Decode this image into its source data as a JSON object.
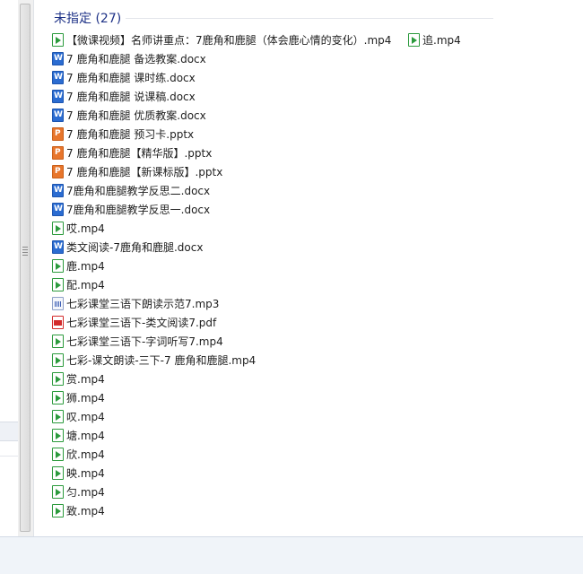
{
  "group": {
    "title": "未指定 (27)"
  },
  "files": [
    {
      "name": "【微课视频】名师讲重点：7鹿角和鹿腿（体会鹿心情的变化）.mp4",
      "icon": "video-file-icon"
    },
    {
      "name": "7 鹿角和鹿腿 备选教案.docx",
      "icon": "word-document-icon"
    },
    {
      "name": "7 鹿角和鹿腿 课时练.docx",
      "icon": "word-document-icon"
    },
    {
      "name": "7 鹿角和鹿腿 说课稿.docx",
      "icon": "word-document-icon"
    },
    {
      "name": "7 鹿角和鹿腿 优质教案.docx",
      "icon": "word-document-icon"
    },
    {
      "name": "7 鹿角和鹿腿 预习卡.pptx",
      "icon": "powerpoint-file-icon"
    },
    {
      "name": "7 鹿角和鹿腿【精华版】.pptx",
      "icon": "powerpoint-file-icon"
    },
    {
      "name": "7 鹿角和鹿腿【新课标版】.pptx",
      "icon": "powerpoint-file-icon"
    },
    {
      "name": "7鹿角和鹿腿教学反思二.docx",
      "icon": "word-document-icon"
    },
    {
      "name": "7鹿角和鹿腿教学反思一.docx",
      "icon": "word-document-icon"
    },
    {
      "name": "哎.mp4",
      "icon": "video-file-icon"
    },
    {
      "name": "类文阅读-7鹿角和鹿腿.docx",
      "icon": "word-document-icon"
    },
    {
      "name": "鹿.mp4",
      "icon": "video-file-icon"
    },
    {
      "name": "配.mp4",
      "icon": "video-file-icon"
    },
    {
      "name": "七彩课堂三语下朗读示范7.mp3",
      "icon": "audio-file-icon"
    },
    {
      "name": "七彩课堂三语下-类文阅读7.pdf",
      "icon": "pdf-file-icon"
    },
    {
      "name": "七彩课堂三语下-字词听写7.mp4",
      "icon": "video-file-icon"
    },
    {
      "name": "七彩-课文朗读-三下-7 鹿角和鹿腿.mp4",
      "icon": "video-file-icon"
    },
    {
      "name": "赏.mp4",
      "icon": "video-file-icon"
    },
    {
      "name": "狮.mp4",
      "icon": "video-file-icon"
    },
    {
      "name": "叹.mp4",
      "icon": "video-file-icon"
    },
    {
      "name": "塘.mp4",
      "icon": "video-file-icon"
    },
    {
      "name": "欣.mp4",
      "icon": "video-file-icon"
    },
    {
      "name": "映.mp4",
      "icon": "video-file-icon"
    },
    {
      "name": "匀.mp4",
      "icon": "video-file-icon"
    },
    {
      "name": "致.mp4",
      "icon": "video-file-icon"
    }
  ],
  "side_file": {
    "name": "追.mp4",
    "icon": "video-file-icon"
  },
  "colors": {
    "group_title": "#1e3287",
    "video_icon": "#2b9a3c",
    "word_icon": "#2b6cd1",
    "ppt_icon": "#e8762c",
    "pdf_icon": "#d22b2b",
    "status_bar": "#f0f4f9"
  }
}
